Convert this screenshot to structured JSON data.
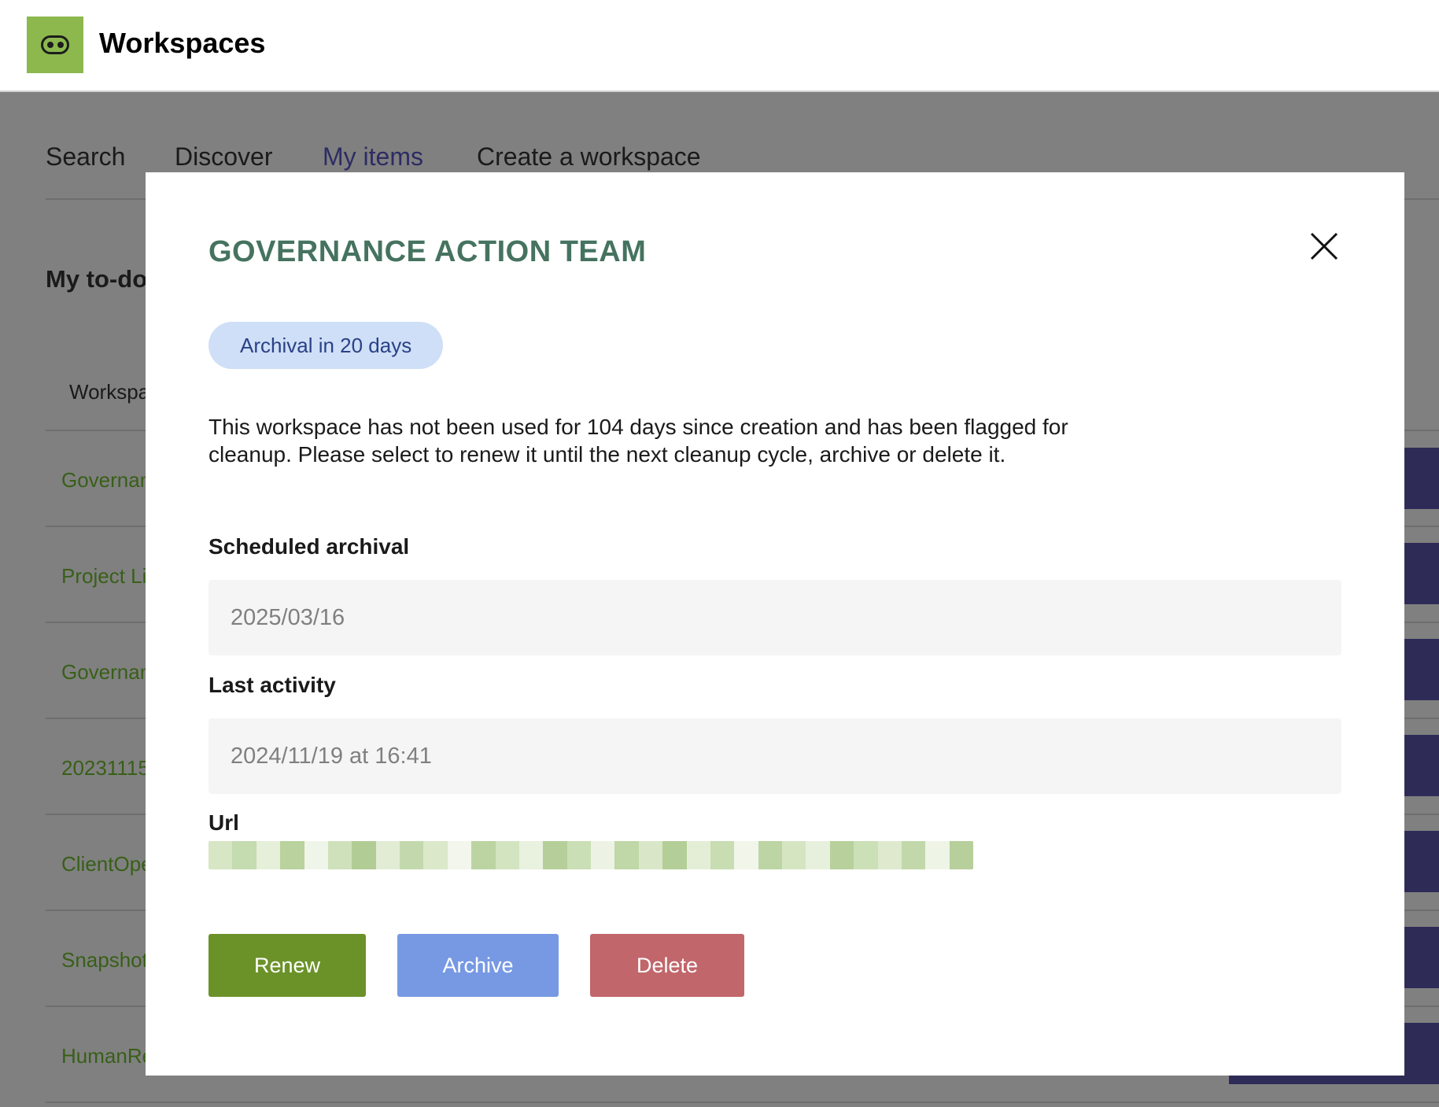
{
  "app": {
    "title": "Workspaces",
    "logo_icon": "mask-icon",
    "brand_color": "#8cb84e"
  },
  "nav": {
    "items": [
      {
        "label": "Search"
      },
      {
        "label": "Discover"
      },
      {
        "label": "My items",
        "active": true
      },
      {
        "label": "Create a workspace"
      }
    ]
  },
  "todo": {
    "title": "My to-do",
    "column_header": "Workspa"
  },
  "rows": [
    {
      "name": "Governan"
    },
    {
      "name": "Project Li"
    },
    {
      "name": "Governan"
    },
    {
      "name": "20231115"
    },
    {
      "name": "ClientOpe"
    },
    {
      "name": "Snapshot"
    },
    {
      "name": "HumanRe"
    }
  ],
  "modal": {
    "title": "GOVERNANCE ACTION TEAM",
    "close_icon": "close-icon",
    "badge": "Archival in 20 days",
    "description": "This workspace has not been used for 104 days since creation and has been flagged for cleanup. Please select to renew it until the next cleanup cycle, archive or delete it.",
    "scheduled_label": "Scheduled archival",
    "scheduled_value": "2025/03/16",
    "last_activity_label": "Last activity",
    "last_activity_value": "2024/11/19 at 16:41",
    "url_label": "Url",
    "renew_label": "Renew",
    "archive_label": "Archive",
    "delete_label": "Delete",
    "colors": {
      "title": "#457360",
      "renew": "#6b9229",
      "archive": "#7799e3",
      "delete": "#c1666b",
      "badge_bg": "#cfdff7"
    }
  }
}
